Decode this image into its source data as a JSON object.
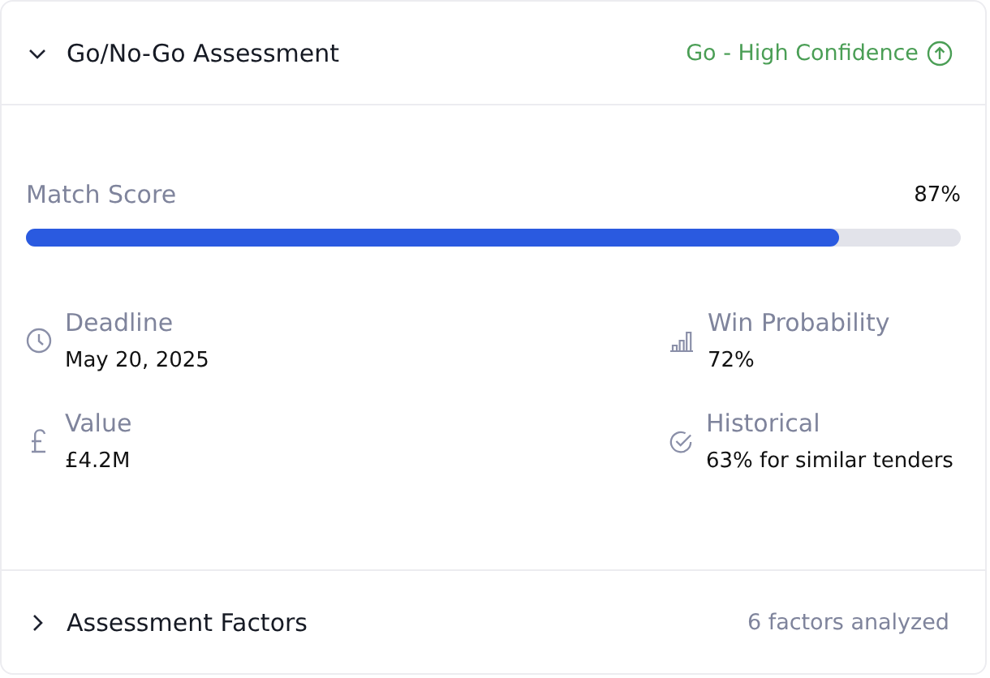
{
  "assessment": {
    "title": "Go/No-Go Assessment",
    "expanded": true,
    "verdict": "Go - High Confidence"
  },
  "match_score": {
    "label": "Match Score",
    "reading": "87%",
    "level": 0.87
  },
  "metrics": [
    {
      "kind": "clock",
      "label": "Deadline",
      "value": "May 20, 2025"
    },
    {
      "kind": "bars",
      "label": "Win Probability",
      "value": "72%"
    },
    {
      "kind": "pound",
      "label": "Value",
      "value": "£4.2M"
    },
    {
      "kind": "check",
      "label": "Historical",
      "value": "63% for similar tenders"
    }
  ],
  "factors": {
    "title": "Assessment Factors",
    "expanded": false,
    "summary": "6 factors analyzed"
  }
}
